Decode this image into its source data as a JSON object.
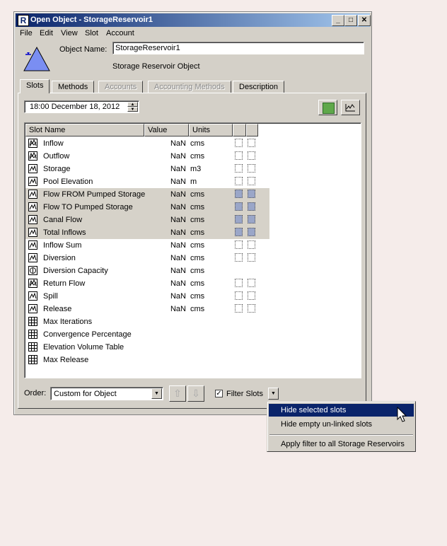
{
  "window": {
    "title": "Open Object - StorageReservoir1",
    "app_icon": "R",
    "controls": [
      "_",
      "□",
      "✕"
    ]
  },
  "menu": [
    "File",
    "Edit",
    "View",
    "Slot",
    "Account"
  ],
  "object": {
    "name_label": "Object Name:",
    "name_value": "StorageReservoir1",
    "type": "Storage Reservoir Object",
    "icon": "reservoir-triangle-icon"
  },
  "tabs": [
    {
      "label": "Slots",
      "active": true,
      "disabled": false
    },
    {
      "label": "Methods",
      "active": false,
      "disabled": false
    },
    {
      "label": "Accounts",
      "active": false,
      "disabled": true
    },
    {
      "label": "Accounting Methods",
      "active": false,
      "disabled": true
    },
    {
      "label": "Description",
      "active": false,
      "disabled": false
    }
  ],
  "date": "18:00 December 18, 2012",
  "table": {
    "headers": [
      "Slot Name",
      "Value",
      "Units"
    ],
    "rows": [
      {
        "name": "Inflow",
        "value": "NaN",
        "units": "cms",
        "icon": "multi-series-icon",
        "selected": false,
        "links": true
      },
      {
        "name": "Outflow",
        "value": "NaN",
        "units": "cms",
        "icon": "multi-series-icon",
        "selected": false,
        "links": true
      },
      {
        "name": "Storage",
        "value": "NaN",
        "units": "m3",
        "icon": "series-icon",
        "selected": false,
        "links": true
      },
      {
        "name": "Pool Elevation",
        "value": "NaN",
        "units": "m",
        "icon": "series-icon",
        "selected": false,
        "links": true
      },
      {
        "name": "Flow FROM Pumped Storage",
        "value": "NaN",
        "units": "cms",
        "icon": "series-icon",
        "selected": true,
        "links": true
      },
      {
        "name": "Flow TO Pumped Storage",
        "value": "NaN",
        "units": "cms",
        "icon": "series-icon",
        "selected": true,
        "links": true
      },
      {
        "name": "Canal Flow",
        "value": "NaN",
        "units": "cms",
        "icon": "series-icon",
        "selected": true,
        "links": true
      },
      {
        "name": "Total Inflows",
        "value": "NaN",
        "units": "cms",
        "icon": "series-icon",
        "selected": true,
        "links": true
      },
      {
        "name": "Inflow Sum",
        "value": "NaN",
        "units": "cms",
        "icon": "series-icon",
        "selected": false,
        "links": true
      },
      {
        "name": "Diversion",
        "value": "NaN",
        "units": "cms",
        "icon": "series-icon",
        "selected": false,
        "links": true
      },
      {
        "name": "Diversion Capacity",
        "value": "NaN",
        "units": "cms",
        "icon": "scalar-icon",
        "selected": false,
        "links": false
      },
      {
        "name": "Return Flow",
        "value": "NaN",
        "units": "cms",
        "icon": "multi-series-icon",
        "selected": false,
        "links": true
      },
      {
        "name": "Spill",
        "value": "NaN",
        "units": "cms",
        "icon": "series-icon",
        "selected": false,
        "links": true
      },
      {
        "name": "Release",
        "value": "NaN",
        "units": "cms",
        "icon": "series-icon",
        "selected": false,
        "links": true
      },
      {
        "name": "Max Iterations",
        "value": "",
        "units": "",
        "icon": "table-icon",
        "selected": false,
        "links": false
      },
      {
        "name": "Convergence Percentage",
        "value": "",
        "units": "",
        "icon": "table-icon",
        "selected": false,
        "links": false
      },
      {
        "name": "Elevation Volume Table",
        "value": "",
        "units": "",
        "icon": "table-icon",
        "selected": false,
        "links": false
      },
      {
        "name": "Max Release",
        "value": "",
        "units": "",
        "icon": "table-icon",
        "selected": false,
        "links": false
      }
    ]
  },
  "order": {
    "label": "Order:",
    "value": "Custom for Object"
  },
  "filter": {
    "label": "Filter Slots",
    "checked": true
  },
  "popup_menu": [
    "Hide selected slots",
    "Hide empty un-linked slots",
    "Apply filter to all Storage Reservoirs"
  ],
  "colors": {
    "face": "#d4d0c8",
    "titlebar": "#0a246a",
    "highlight": "#0a246a",
    "selected_row": "#d6d2c9",
    "green_button": "#5fa84a"
  }
}
